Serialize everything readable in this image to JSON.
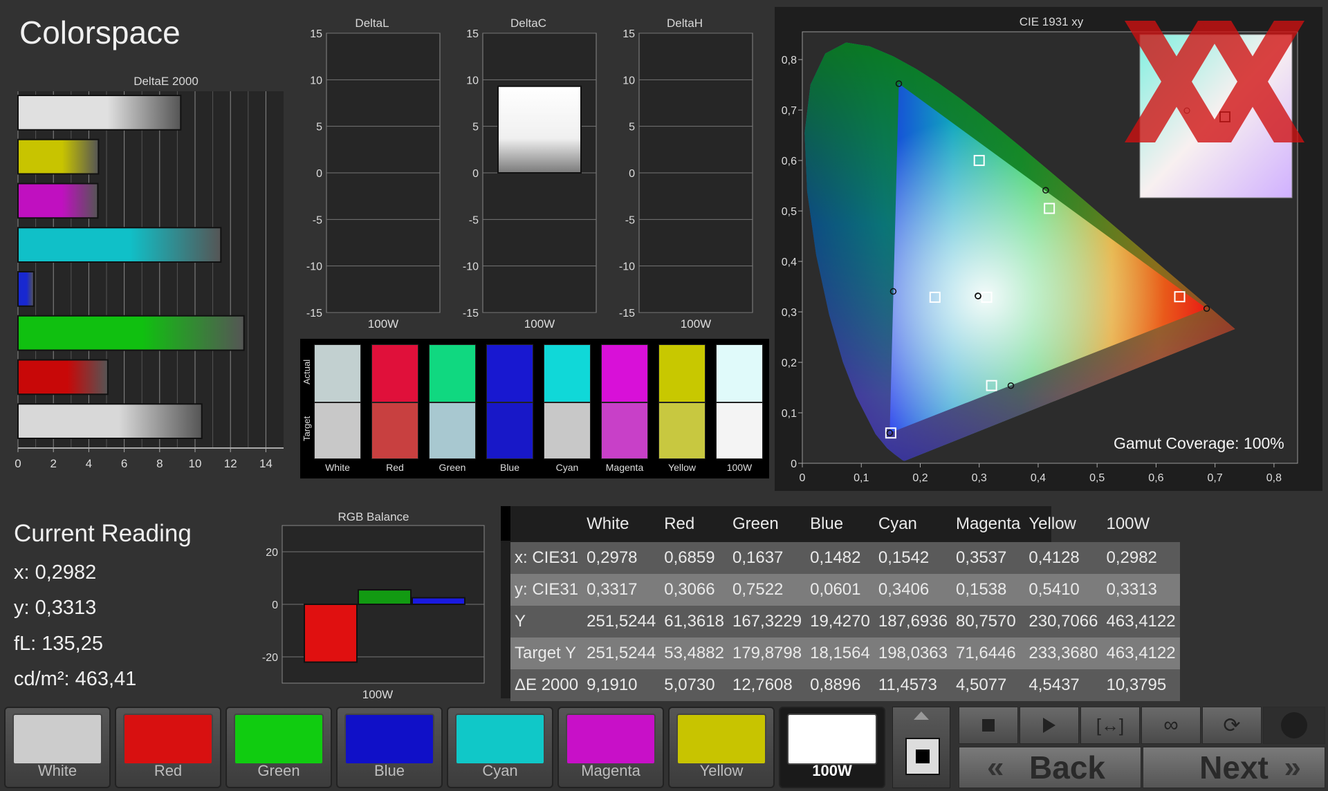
{
  "page": {
    "title": "Colorspace"
  },
  "deltae_chart": {
    "title": "DeltaE 2000",
    "x_ticks": [
      "0",
      "2",
      "4",
      "6",
      "8",
      "10",
      "12",
      "14"
    ],
    "xlim": [
      0,
      15
    ],
    "bars": [
      {
        "name": "White",
        "value": 9.191,
        "color": "#e0e0e0"
      },
      {
        "name": "Yellow",
        "value": 4.5437,
        "color": "#c8c400"
      },
      {
        "name": "Magenta",
        "value": 4.5077,
        "color": "#c010c0"
      },
      {
        "name": "Cyan",
        "value": 11.4573,
        "color": "#10c0c8"
      },
      {
        "name": "Blue",
        "value": 0.8896,
        "color": "#1828d0"
      },
      {
        "name": "Green",
        "value": 12.7608,
        "color": "#10c010"
      },
      {
        "name": "Red",
        "value": 5.073,
        "color": "#c80808"
      },
      {
        "name": "100W",
        "value": 10.3795,
        "color": "#d8d8d8"
      }
    ]
  },
  "delta_charts": [
    {
      "title": "DeltaL",
      "xlabel": "100W",
      "value": 0,
      "y_ticks": [
        "15",
        "10",
        "5",
        "0",
        "-5",
        "-10",
        "-15"
      ]
    },
    {
      "title": "DeltaC",
      "xlabel": "100W",
      "value": 9.3,
      "y_ticks": [
        "15",
        "10",
        "5",
        "0",
        "-5",
        "-10",
        "-15"
      ]
    },
    {
      "title": "DeltaH",
      "xlabel": "100W",
      "value": 0,
      "y_ticks": [
        "15",
        "10",
        "5",
        "0",
        "-5",
        "-10",
        "-15"
      ]
    }
  ],
  "swatches": {
    "side_labels": {
      "actual": "Actual",
      "target": "Target"
    },
    "items": [
      {
        "label": "White",
        "actual": "#c2d0d0",
        "target": "#c8c8c8"
      },
      {
        "label": "Red",
        "actual": "#e0103a",
        "target": "#c84040"
      },
      {
        "label": "Green",
        "actual": "#10d880",
        "target": "#a8c8d0"
      },
      {
        "label": "Blue",
        "actual": "#1818d0",
        "target": "#1818c8"
      },
      {
        "label": "Cyan",
        "actual": "#10d8d8",
        "target": "#c8c8c8"
      },
      {
        "label": "Magenta",
        "actual": "#d810d8",
        "target": "#c840c8"
      },
      {
        "label": "Yellow",
        "actual": "#c8c800",
        "target": "#c8c840"
      },
      {
        "label": "100W",
        "actual": "#e0fafa",
        "target": "#f4f4f4"
      }
    ]
  },
  "cie": {
    "title": "CIE 1931 xy",
    "x_ticks": [
      "0",
      "0,1",
      "0,2",
      "0,3",
      "0,4",
      "0,5",
      "0,6",
      "0,7",
      "0,8"
    ],
    "y_ticks": [
      "0",
      "0,1",
      "0,2",
      "0,3",
      "0,4",
      "0,5",
      "0,6",
      "0,7",
      "0,8"
    ],
    "gamut_coverage": "Gamut Coverage:  100%",
    "measured": [
      [
        0.2978,
        0.3317
      ],
      [
        0.6859,
        0.3066
      ],
      [
        0.1637,
        0.7522
      ],
      [
        0.1482,
        0.0601
      ],
      [
        0.1542,
        0.3406
      ],
      [
        0.3537,
        0.1538
      ],
      [
        0.4128,
        0.541
      ],
      [
        0.2982,
        0.3313
      ]
    ],
    "targets": [
      [
        0.3127,
        0.329
      ],
      [
        0.64,
        0.33
      ],
      [
        0.3,
        0.6
      ],
      [
        0.15,
        0.06
      ],
      [
        0.225,
        0.329
      ],
      [
        0.321,
        0.154
      ],
      [
        0.419,
        0.505
      ],
      [
        0.3127,
        0.329
      ]
    ]
  },
  "current_reading": {
    "title": "Current Reading",
    "lines": [
      "x: 0,2982",
      "y: 0,3313",
      "fL: 135,25",
      "cd/m²: 463,41"
    ]
  },
  "rgb_balance": {
    "title": "RGB Balance",
    "xlabel": "100W",
    "y_ticks": [
      "20",
      "0",
      "-20"
    ],
    "ylim": [
      -30,
      30
    ],
    "series": [
      {
        "name": "R",
        "value": -22,
        "color": "#e01010"
      },
      {
        "name": "G",
        "value": 5.5,
        "color": "#129a12"
      },
      {
        "name": "B",
        "value": 2.5,
        "color": "#1a1ae0"
      }
    ]
  },
  "table": {
    "columns": [
      "",
      "White",
      "Red",
      "Green",
      "Blue",
      "Cyan",
      "Magenta",
      "Yellow",
      "100W"
    ],
    "rows": [
      [
        "x: CIE31",
        "0,2978",
        "0,6859",
        "0,1637",
        "0,1482",
        "0,1542",
        "0,3537",
        "0,4128",
        "0,2982"
      ],
      [
        "y: CIE31",
        "0,3317",
        "0,3066",
        "0,7522",
        "0,0601",
        "0,3406",
        "0,1538",
        "0,5410",
        "0,3313"
      ],
      [
        "Y",
        "251,5244",
        "61,3618",
        "167,3229",
        "19,4270",
        "187,6936",
        "80,7570",
        "230,7066",
        "463,4122"
      ],
      [
        "Target Y",
        "251,5244",
        "53,4882",
        "179,8798",
        "18,1564",
        "198,0363",
        "71,6446",
        "233,3680",
        "463,4122"
      ],
      [
        "ΔE 2000",
        "9,1910",
        "5,0730",
        "12,7608",
        "0,8896",
        "11,4573",
        "4,5077",
        "4,5437",
        "10,3795"
      ]
    ]
  },
  "buttons": [
    {
      "label": "White",
      "color": "#cccccc"
    },
    {
      "label": "Red",
      "color": "#d81010"
    },
    {
      "label": "Green",
      "color": "#10cc10"
    },
    {
      "label": "Blue",
      "color": "#1010c8"
    },
    {
      "label": "Cyan",
      "color": "#10c8c8"
    },
    {
      "label": "Magenta",
      "color": "#c810c8"
    },
    {
      "label": "Yellow",
      "color": "#c8c400"
    },
    {
      "label": "100W",
      "color": "#ffffff"
    }
  ],
  "nav": {
    "back": "Back",
    "next": "Next",
    "back_arrow": "«",
    "next_arrow": "»"
  },
  "controls": [
    "stop-icon",
    "play-icon",
    "fit-icon",
    "loop-icon",
    "refresh-icon"
  ]
}
